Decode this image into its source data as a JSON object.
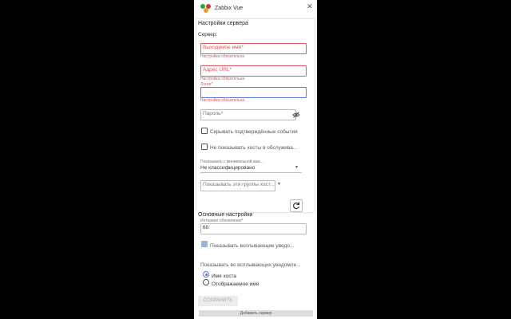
{
  "app": {
    "title": "Zabbix Vue"
  },
  "server_settings": {
    "title": "Настройки сервера",
    "server_label": "Сервер:",
    "fields": {
      "name": {
        "placeholder": "Выходимое имя*",
        "error": "Настройка обязательна"
      },
      "url": {
        "placeholder": "Адрес URL*",
        "error": "Настройка обязательна"
      },
      "login": {
        "label": "Логин*",
        "value": "",
        "error": "Настройка обязательна"
      },
      "password": {
        "placeholder": "Пароль*"
      }
    },
    "checkboxes": {
      "hide_ack": "Скрывать подтверждённые события",
      "hide_maint": "Не показывать хосты в обслужива..."
    },
    "min_severity": {
      "label": "Показывать с минимальной важ...",
      "value": "Не классифицировано"
    },
    "host_groups": {
      "placeholder": "Показывать эти группы хост..."
    }
  },
  "main_settings": {
    "title": "Основные настройки",
    "interval": {
      "label": "Интервал обновления*",
      "value": "60"
    },
    "show_popups": "Показывать всплывающие уведо...",
    "popup_label": "Показывать во всплывающих уведомле...",
    "radios": {
      "host_name": "Имя хоста",
      "display_name": "Отображаемое имя"
    }
  },
  "actions": {
    "save": "СОХРАНИТЬ",
    "add_server": "Добавить сервер"
  },
  "colors": {
    "error": "#e05757",
    "accent": "#5b7bd5"
  }
}
